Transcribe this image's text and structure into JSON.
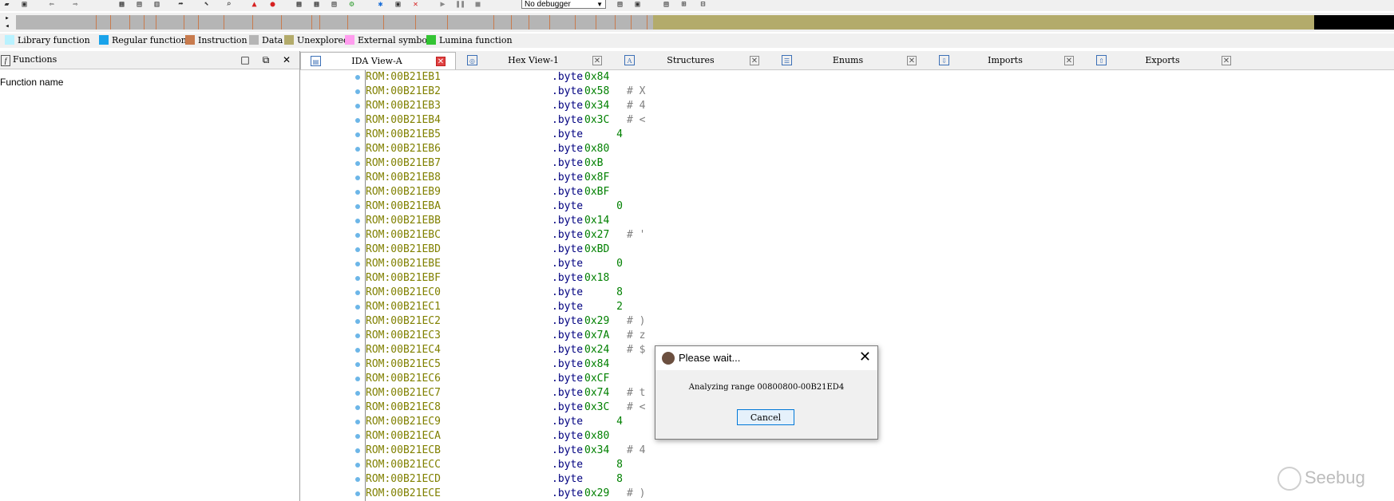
{
  "toolbar": {
    "debugger_select": "No debugger"
  },
  "legend": [
    {
      "label": "Library function",
      "color": "#b9f2ff"
    },
    {
      "label": "Regular function",
      "color": "#1aa3ea"
    },
    {
      "label": "Instruction",
      "color": "#c87b4e"
    },
    {
      "label": "Data",
      "color": "#b5b5b5"
    },
    {
      "label": "Unexplored",
      "color": "#b3ab6b"
    },
    {
      "label": "External symbol",
      "color": "#ff9dee"
    },
    {
      "label": "Lumina function",
      "color": "#33c433"
    }
  ],
  "functions_panel": {
    "title": "Functions",
    "column_header": "Function name"
  },
  "tabs": [
    {
      "label": "IDA View-A",
      "active": true
    },
    {
      "label": "Hex View-1",
      "active": false
    },
    {
      "label": "Structures",
      "active": false
    },
    {
      "label": "Enums",
      "active": false
    },
    {
      "label": "Imports",
      "active": false
    },
    {
      "label": "Exports",
      "active": false
    }
  ],
  "disassembly": [
    {
      "addr": "ROM:00B21EB1",
      "ins": ".byte",
      "val": "0x84",
      "cmt": ""
    },
    {
      "addr": "ROM:00B21EB2",
      "ins": ".byte",
      "val": "0x58",
      "cmt": "# X"
    },
    {
      "addr": "ROM:00B21EB3",
      "ins": ".byte",
      "val": "0x34",
      "cmt": "# 4"
    },
    {
      "addr": "ROM:00B21EB4",
      "ins": ".byte",
      "val": "0x3C",
      "cmt": "# <"
    },
    {
      "addr": "ROM:00B21EB5",
      "ins": ".byte",
      "val": "4",
      "cmt": ""
    },
    {
      "addr": "ROM:00B21EB6",
      "ins": ".byte",
      "val": "0x80",
      "cmt": ""
    },
    {
      "addr": "ROM:00B21EB7",
      "ins": ".byte",
      "val": "0xB",
      "cmt": ""
    },
    {
      "addr": "ROM:00B21EB8",
      "ins": ".byte",
      "val": "0x8F",
      "cmt": ""
    },
    {
      "addr": "ROM:00B21EB9",
      "ins": ".byte",
      "val": "0xBF",
      "cmt": ""
    },
    {
      "addr": "ROM:00B21EBA",
      "ins": ".byte",
      "val": "0",
      "cmt": ""
    },
    {
      "addr": "ROM:00B21EBB",
      "ins": ".byte",
      "val": "0x14",
      "cmt": ""
    },
    {
      "addr": "ROM:00B21EBC",
      "ins": ".byte",
      "val": "0x27",
      "cmt": "# '"
    },
    {
      "addr": "ROM:00B21EBD",
      "ins": ".byte",
      "val": "0xBD",
      "cmt": ""
    },
    {
      "addr": "ROM:00B21EBE",
      "ins": ".byte",
      "val": "0",
      "cmt": ""
    },
    {
      "addr": "ROM:00B21EBF",
      "ins": ".byte",
      "val": "0x18",
      "cmt": ""
    },
    {
      "addr": "ROM:00B21EC0",
      "ins": ".byte",
      "val": "8",
      "cmt": ""
    },
    {
      "addr": "ROM:00B21EC1",
      "ins": ".byte",
      "val": "2",
      "cmt": ""
    },
    {
      "addr": "ROM:00B21EC2",
      "ins": ".byte",
      "val": "0x29",
      "cmt": "# )"
    },
    {
      "addr": "ROM:00B21EC3",
      "ins": ".byte",
      "val": "0x7A",
      "cmt": "# z"
    },
    {
      "addr": "ROM:00B21EC4",
      "ins": ".byte",
      "val": "0x24",
      "cmt": "# $"
    },
    {
      "addr": "ROM:00B21EC5",
      "ins": ".byte",
      "val": "0x84",
      "cmt": ""
    },
    {
      "addr": "ROM:00B21EC6",
      "ins": ".byte",
      "val": "0xCF",
      "cmt": ""
    },
    {
      "addr": "ROM:00B21EC7",
      "ins": ".byte",
      "val": "0x74",
      "cmt": "# t"
    },
    {
      "addr": "ROM:00B21EC8",
      "ins": ".byte",
      "val": "0x3C",
      "cmt": "# <"
    },
    {
      "addr": "ROM:00B21EC9",
      "ins": ".byte",
      "val": "4",
      "cmt": ""
    },
    {
      "addr": "ROM:00B21ECA",
      "ins": ".byte",
      "val": "0x80",
      "cmt": ""
    },
    {
      "addr": "ROM:00B21ECB",
      "ins": ".byte",
      "val": "0x34",
      "cmt": "# 4"
    },
    {
      "addr": "ROM:00B21ECC",
      "ins": ".byte",
      "val": "8",
      "cmt": ""
    },
    {
      "addr": "ROM:00B21ECD",
      "ins": ".byte",
      "val": "8",
      "cmt": ""
    },
    {
      "addr": "ROM:00B21ECE",
      "ins": ".byte",
      "val": "0x29",
      "cmt": "# )"
    }
  ],
  "dialog": {
    "title": "Please wait...",
    "message": "Analyzing range 00800800-00B21ED4",
    "cancel_label": "Cancel",
    "close_glyph": "✕"
  },
  "watermark": {
    "text": "Seebug"
  }
}
